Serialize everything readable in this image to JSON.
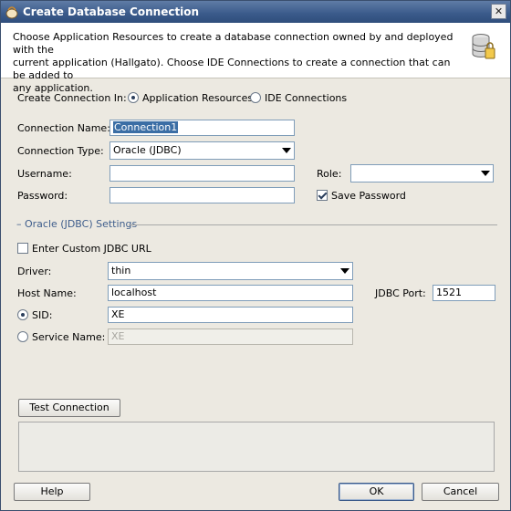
{
  "window": {
    "title": "Create Database Connection",
    "close_glyph": "✕"
  },
  "header": {
    "description_line1": "Choose Application Resources to create a database connection owned by and deployed with the",
    "description_line2": "current application (Hallgato). Choose IDE Connections to create a connection that can be added to",
    "description_line3": "any application."
  },
  "create_in": {
    "label": "Create Connection In:",
    "options": [
      "Application Resources",
      "IDE Connections"
    ],
    "selected": "Application Resources"
  },
  "connection": {
    "name_label": "Connection Name:",
    "name_value": "Connection1",
    "type_label": "Connection Type:",
    "type_value": "Oracle (JDBC)",
    "username_label": "Username:",
    "username_value": "",
    "password_label": "Password:",
    "password_value": "",
    "role_label": "Role:",
    "role_value": "",
    "save_password_label": "Save Password",
    "save_password_checked": true
  },
  "settings": {
    "section_title": "Oracle (JDBC) Settings",
    "custom_url_label": "Enter Custom JDBC URL",
    "custom_url_checked": false,
    "driver_label": "Driver:",
    "driver_value": "thin",
    "host_label": "Host Name:",
    "host_value": "localhost",
    "port_label": "JDBC Port:",
    "port_value": "1521",
    "sid_label": "SID:",
    "sid_value": "XE",
    "service_label": "Service Name:",
    "service_value": "XE",
    "selected_mode": "SID"
  },
  "buttons": {
    "test_connection": "Test Connection",
    "help": "Help",
    "ok": "OK",
    "cancel": "Cancel"
  }
}
